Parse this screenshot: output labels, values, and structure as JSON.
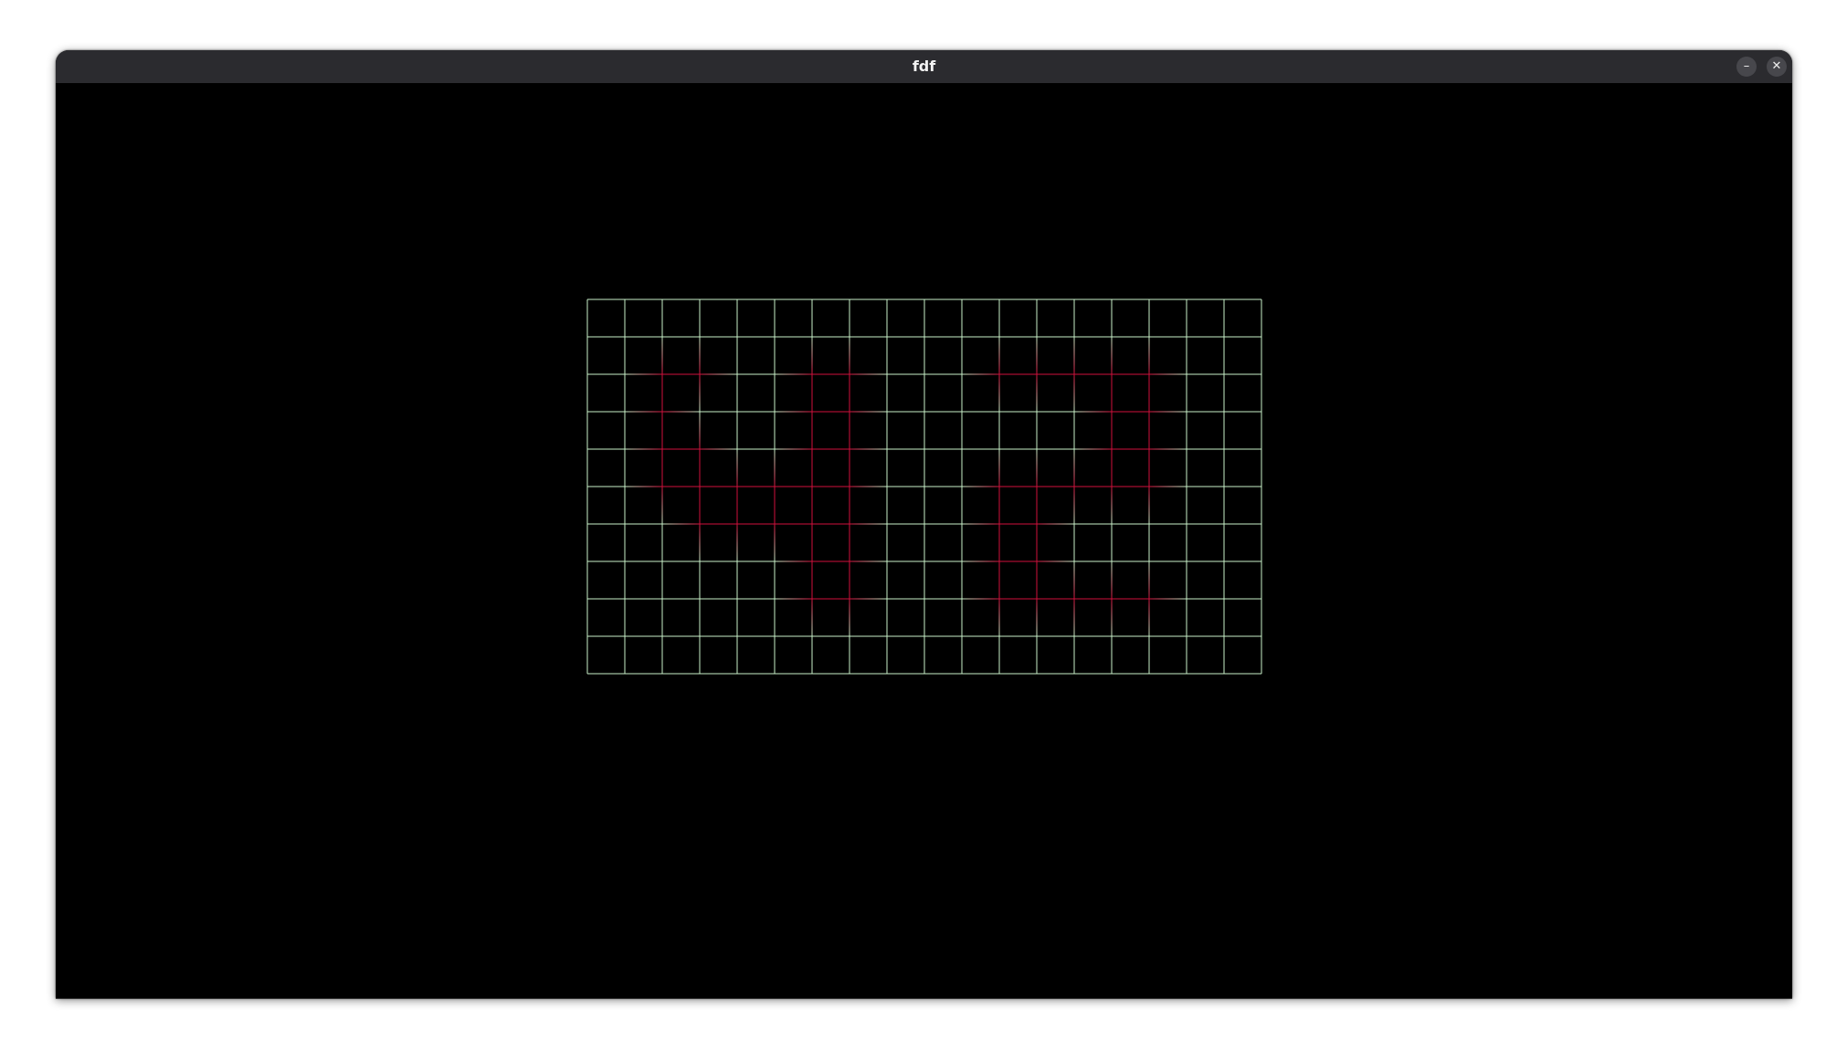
{
  "window": {
    "title": "fdf",
    "minimize_glyph": "–",
    "close_glyph": "✕"
  },
  "icons": {
    "minimize": "minimize-icon",
    "close": "close-icon"
  },
  "map": {
    "columns": 19,
    "rows": 11,
    "base_color": "#c8f0c8",
    "elevated_color": "#d0103c",
    "elevated_points": [
      [
        2,
        2
      ],
      [
        3,
        2
      ],
      [
        2,
        3
      ],
      [
        2,
        4
      ],
      [
        3,
        4
      ],
      [
        2,
        5
      ],
      [
        3,
        5
      ],
      [
        4,
        5
      ],
      [
        5,
        5
      ],
      [
        3,
        6
      ],
      [
        4,
        6
      ],
      [
        5,
        6
      ],
      [
        6,
        2
      ],
      [
        7,
        2
      ],
      [
        6,
        3
      ],
      [
        7,
        3
      ],
      [
        6,
        4
      ],
      [
        7,
        4
      ],
      [
        6,
        5
      ],
      [
        7,
        5
      ],
      [
        6,
        6
      ],
      [
        7,
        6
      ],
      [
        6,
        7
      ],
      [
        7,
        7
      ],
      [
        6,
        8
      ],
      [
        7,
        8
      ],
      [
        11,
        2
      ],
      [
        12,
        2
      ],
      [
        13,
        2
      ],
      [
        14,
        2
      ],
      [
        15,
        2
      ],
      [
        14,
        3
      ],
      [
        15,
        3
      ],
      [
        14,
        4
      ],
      [
        15,
        4
      ],
      [
        11,
        5
      ],
      [
        12,
        5
      ],
      [
        13,
        5
      ],
      [
        14,
        5
      ],
      [
        15,
        5
      ],
      [
        11,
        6
      ],
      [
        12,
        6
      ],
      [
        11,
        7
      ],
      [
        12,
        7
      ],
      [
        11,
        8
      ],
      [
        12,
        8
      ],
      [
        13,
        8
      ],
      [
        14,
        8
      ],
      [
        15,
        8
      ]
    ]
  }
}
